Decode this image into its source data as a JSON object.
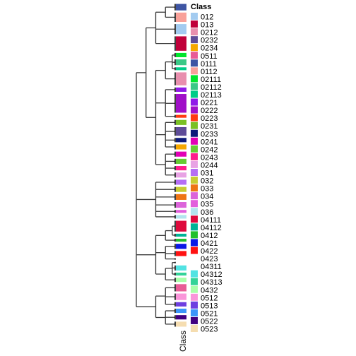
{
  "chart_data": {
    "type": "heatmap",
    "title": "",
    "annotation_name": "Class",
    "legend": {
      "title": "Class",
      "placement": "right",
      "entries": [
        {
          "label": "012",
          "color": "#A3CBF0"
        },
        {
          "label": "013",
          "color": "#C0003A"
        },
        {
          "label": "0212",
          "color": "#E88FAE"
        },
        {
          "label": "0232",
          "color": "#5E4C98"
        },
        {
          "label": "0234",
          "color": "#F6A800"
        },
        {
          "label": "0511",
          "color": "#E85C96"
        },
        {
          "label": "0111",
          "color": "#3E55A3"
        },
        {
          "label": "0112",
          "color": "#F9A19A"
        },
        {
          "label": "02111",
          "color": "#00E52D"
        },
        {
          "label": "02112",
          "color": "#3AC886"
        },
        {
          "label": "02113",
          "color": "#00CC88"
        },
        {
          "label": "0221",
          "color": "#8F1AE8"
        },
        {
          "label": "0222",
          "color": "#A010C8"
        },
        {
          "label": "0223",
          "color": "#FF3B12"
        },
        {
          "label": "0231",
          "color": "#7AC025"
        },
        {
          "label": "0233",
          "color": "#0D1B7A"
        },
        {
          "label": "0241",
          "color": "#E200B6"
        },
        {
          "label": "0242",
          "color": "#66CC33"
        },
        {
          "label": "0243",
          "color": "#FF1C8C"
        },
        {
          "label": "0244",
          "color": "#E8A2E4"
        },
        {
          "label": "031",
          "color": "#B56EF5"
        },
        {
          "label": "032",
          "color": "#C8CC34"
        },
        {
          "label": "033",
          "color": "#EE7415"
        },
        {
          "label": "034",
          "color": "#DC64DA"
        },
        {
          "label": "035",
          "color": "#E25FDC"
        },
        {
          "label": "036",
          "color": "#B2E5EE"
        },
        {
          "label": "04111",
          "color": "#DE0A3C"
        },
        {
          "label": "04112",
          "color": "#00B496"
        },
        {
          "label": "0412",
          "color": "#22C02D"
        },
        {
          "label": "0421",
          "color": "#0B18E6"
        },
        {
          "label": "0422",
          "color": "#FF1212"
        },
        {
          "label": "0423",
          "color": "#FFFFFF"
        },
        {
          "label": "04311",
          "color": "#FFFFFF"
        },
        {
          "label": "04312",
          "color": "#52E3E3"
        },
        {
          "label": "04313",
          "color": "#33D398"
        },
        {
          "label": "0432",
          "color": "#AAFFAA"
        },
        {
          "label": "0512",
          "color": "#FA96DA"
        },
        {
          "label": "0513",
          "color": "#6E3FE0"
        },
        {
          "label": "0521",
          "color": "#3B96FA"
        },
        {
          "label": "0522",
          "color": "#400080"
        },
        {
          "label": "0523",
          "color": "#F5DDB0"
        }
      ]
    },
    "rows": [
      {
        "class": "0111",
        "weight": 9
      },
      {
        "class": "0112",
        "weight": 13
      },
      {
        "class": "012",
        "weight": 14
      },
      {
        "class": "013",
        "weight": 20
      },
      {
        "class": "02111",
        "weight": 6
      },
      {
        "class": "02112",
        "weight": 8
      },
      {
        "class": "02113",
        "weight": 4
      },
      {
        "class": "0212",
        "weight": 18
      },
      {
        "class": "0221",
        "weight": 6
      },
      {
        "class": "0222",
        "weight": 26
      },
      {
        "class": "0223",
        "weight": 4
      },
      {
        "class": "0231",
        "weight": 7
      },
      {
        "class": "0232",
        "weight": 12
      },
      {
        "class": "0233",
        "weight": 6
      },
      {
        "class": "0234",
        "weight": 7
      },
      {
        "class": "0241",
        "weight": 7
      },
      {
        "class": "0242",
        "weight": 7
      },
      {
        "class": "0243",
        "weight": 6
      },
      {
        "class": "0244",
        "weight": 7
      },
      {
        "class": "031",
        "weight": 7
      },
      {
        "class": "032",
        "weight": 7
      },
      {
        "class": "033",
        "weight": 8
      },
      {
        "class": "034",
        "weight": 8
      },
      {
        "class": "035",
        "weight": 4
      },
      {
        "class": "036",
        "weight": 5
      },
      {
        "class": "04111",
        "weight": 15
      },
      {
        "class": "04112",
        "weight": 4
      },
      {
        "class": "0412",
        "weight": 4
      },
      {
        "class": "0421",
        "weight": 7
      },
      {
        "class": "0422",
        "weight": 7
      },
      {
        "class": "0423",
        "weight": 2
      },
      {
        "class": "04311",
        "weight": 2
      },
      {
        "class": "04312",
        "weight": 7
      },
      {
        "class": "04313",
        "weight": 4
      },
      {
        "class": "0432",
        "weight": 6
      },
      {
        "class": "0511",
        "weight": 10
      },
      {
        "class": "0512",
        "weight": 9
      },
      {
        "class": "0513",
        "weight": 6
      },
      {
        "class": "0521",
        "weight": 6
      },
      {
        "class": "0522",
        "weight": 6
      },
      {
        "class": "0523",
        "weight": 7
      }
    ],
    "dendrogram": {
      "max_height": 4,
      "tree": {
        "h": 4,
        "c": [
          {
            "h": 3,
            "c": [
              {
                "h": 2,
                "c": [
                  {
                    "h": 1,
                    "c": [
                      {
                        "leaf": 0
                      },
                      {
                        "leaf": 1
                      }
                    ]
                  },
                  {
                    "leaf": 2
                  },
                  {
                    "leaf": 3
                  }
                ]
              },
              {
                "h": 2,
                "c": [
                  {
                    "h": 2,
                    "c": [
                      {
                        "h": 1,
                        "c": [
                          {
                            "h": 0.3,
                            "c": [
                              {
                                "leaf": 4
                              },
                              {
                                "leaf": 5
                              },
                              {
                                "leaf": 6
                              }
                            ]
                          },
                          {
                            "leaf": 7
                          }
                        ]
                      },
                      {
                        "h": 1,
                        "c": [
                          {
                            "leaf": 8
                          },
                          {
                            "leaf": 9
                          },
                          {
                            "leaf": 10
                          }
                        ]
                      },
                      {
                        "h": 1,
                        "c": [
                          {
                            "leaf": 11
                          },
                          {
                            "leaf": 12
                          },
                          {
                            "leaf": 13
                          },
                          {
                            "leaf": 14
                          }
                        ]
                      },
                      {
                        "h": 1,
                        "c": [
                          {
                            "leaf": 15
                          },
                          {
                            "leaf": 16
                          },
                          {
                            "leaf": 17
                          },
                          {
                            "leaf": 18
                          }
                        ]
                      }
                    ]
                  }
                ]
              }
            ]
          },
          {
            "h": 2,
            "c": [
              {
                "leaf": 19
              },
              {
                "leaf": 20
              },
              {
                "leaf": 21
              },
              {
                "leaf": 22
              },
              {
                "leaf": 23
              },
              {
                "leaf": 24
              }
            ]
          },
          {
            "h": 2,
            "c": [
              {
                "h": 1,
                "c": [
                  {
                    "h": 0.3,
                    "c": [
                      {
                        "leaf": 25
                      },
                      {
                        "leaf": 26
                      }
                    ]
                  },
                  {
                    "leaf": 27
                  }
                ]
              },
              {
                "h": 1,
                "c": [
                  {
                    "leaf": 28
                  },
                  {
                    "leaf": 29
                  },
                  {
                    "leaf": 30
                  }
                ]
              },
              {
                "h": 1,
                "c": [
                  {
                    "h": 0.3,
                    "c": [
                      {
                        "leaf": 31
                      },
                      {
                        "leaf": 32
                      },
                      {
                        "leaf": 33
                      }
                    ]
                  },
                  {
                    "leaf": 34
                  }
                ]
              }
            ]
          },
          {
            "h": 2,
            "c": [
              {
                "h": 1,
                "c": [
                  {
                    "leaf": 35
                  },
                  {
                    "leaf": 36
                  },
                  {
                    "leaf": 37
                  }
                ]
              },
              {
                "h": 1,
                "c": [
                  {
                    "leaf": 38
                  },
                  {
                    "leaf": 39
                  },
                  {
                    "leaf": 40
                  }
                ]
              }
            ]
          }
        ]
      }
    }
  }
}
